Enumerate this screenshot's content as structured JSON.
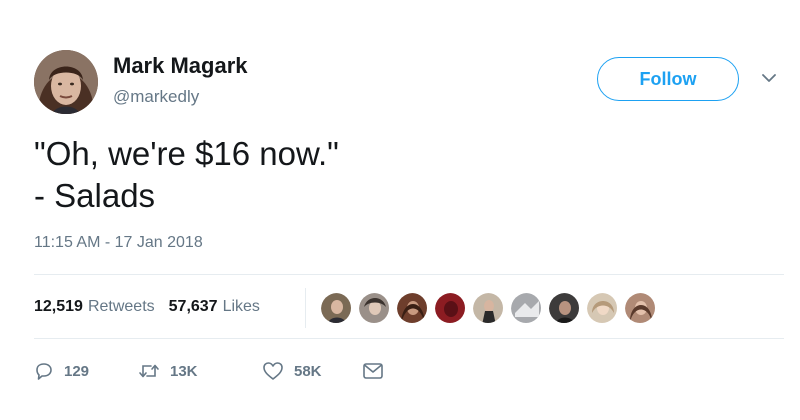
{
  "user": {
    "name": "Mark Magark",
    "handle": "@markedly"
  },
  "follow_label": "Follow",
  "tweet": {
    "lines": [
      "\"Oh, we're $16 now.\"",
      "- Salads"
    ]
  },
  "timestamp": "11:15 AM - 17 Jan 2018",
  "stats": {
    "retweets_count": "12,519",
    "retweets_label": "Retweets",
    "likes_count": "57,637",
    "likes_label": "Likes"
  },
  "liker_avatars": [
    {
      "color": "#7b6a55"
    },
    {
      "color": "#9a9089"
    },
    {
      "color": "#6e3e2c"
    },
    {
      "color": "#8c1c22"
    },
    {
      "color": "#c4b7a6"
    },
    {
      "color": "#a7a9ad"
    },
    {
      "color": "#3d3b3b"
    },
    {
      "color": "#d6c8b4"
    },
    {
      "color": "#b08a76"
    }
  ],
  "actions": {
    "reply_count": "129",
    "retweet_count": "13K",
    "like_count": "58K"
  },
  "colors": {
    "accent": "#1da1f2",
    "secondary_text": "#657786",
    "divider": "#e6ecf0"
  }
}
